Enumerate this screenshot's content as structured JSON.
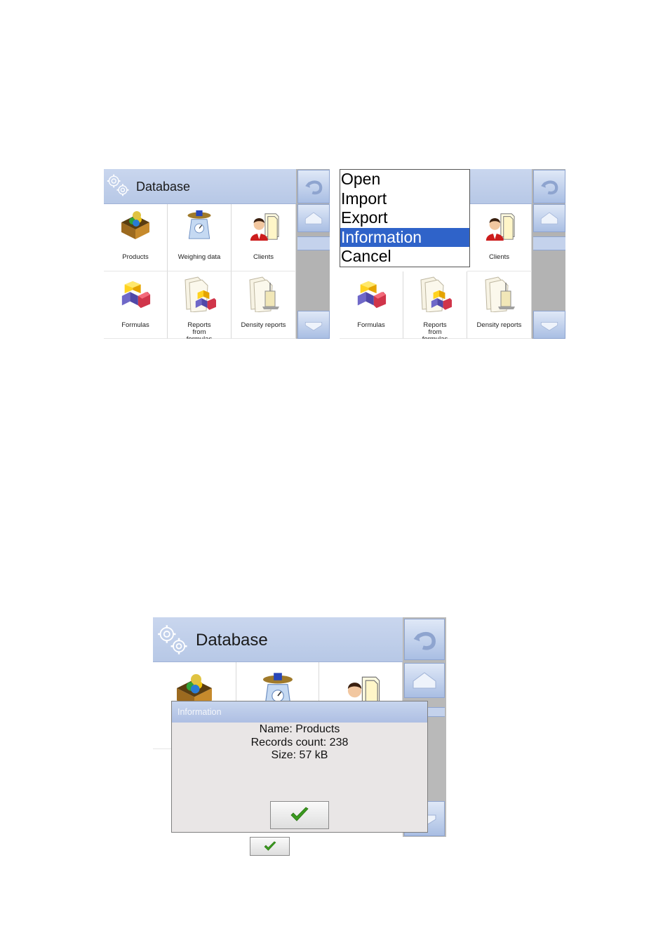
{
  "screen_top": {
    "title": "Database",
    "tiles": [
      {
        "label": "Products",
        "icon": "products-box-icon"
      },
      {
        "label": "Weighing data",
        "icon": "weighing-scale-icon"
      },
      {
        "label": "Clients",
        "icon": "clients-icon"
      },
      {
        "label": "Formulas",
        "icon": "formulas-cubes-icon"
      },
      {
        "label": "Reports from formulas",
        "icon": "reports-formulas-icon"
      },
      {
        "label": "Density reports",
        "icon": "density-reports-icon"
      }
    ]
  },
  "screen_menu": {
    "context_menu": {
      "items": [
        "Open",
        "Import",
        "Export",
        "Information",
        "Cancel"
      ],
      "selected": "Information"
    },
    "tiles": [
      {
        "label": "Clients"
      },
      {
        "label": "Formulas"
      },
      {
        "label": "Reports from formulas"
      },
      {
        "label": "Density reports"
      }
    ]
  },
  "screen_info": {
    "title": "Database",
    "dialog": {
      "title": "Information",
      "name_line": "Name: Products",
      "records_line": "Records count: 238",
      "size_line": "Size: 57 kB"
    }
  },
  "colors": {
    "header": "#c3d1ec",
    "selection": "#2f63c9",
    "check": "#3a9a1f"
  }
}
